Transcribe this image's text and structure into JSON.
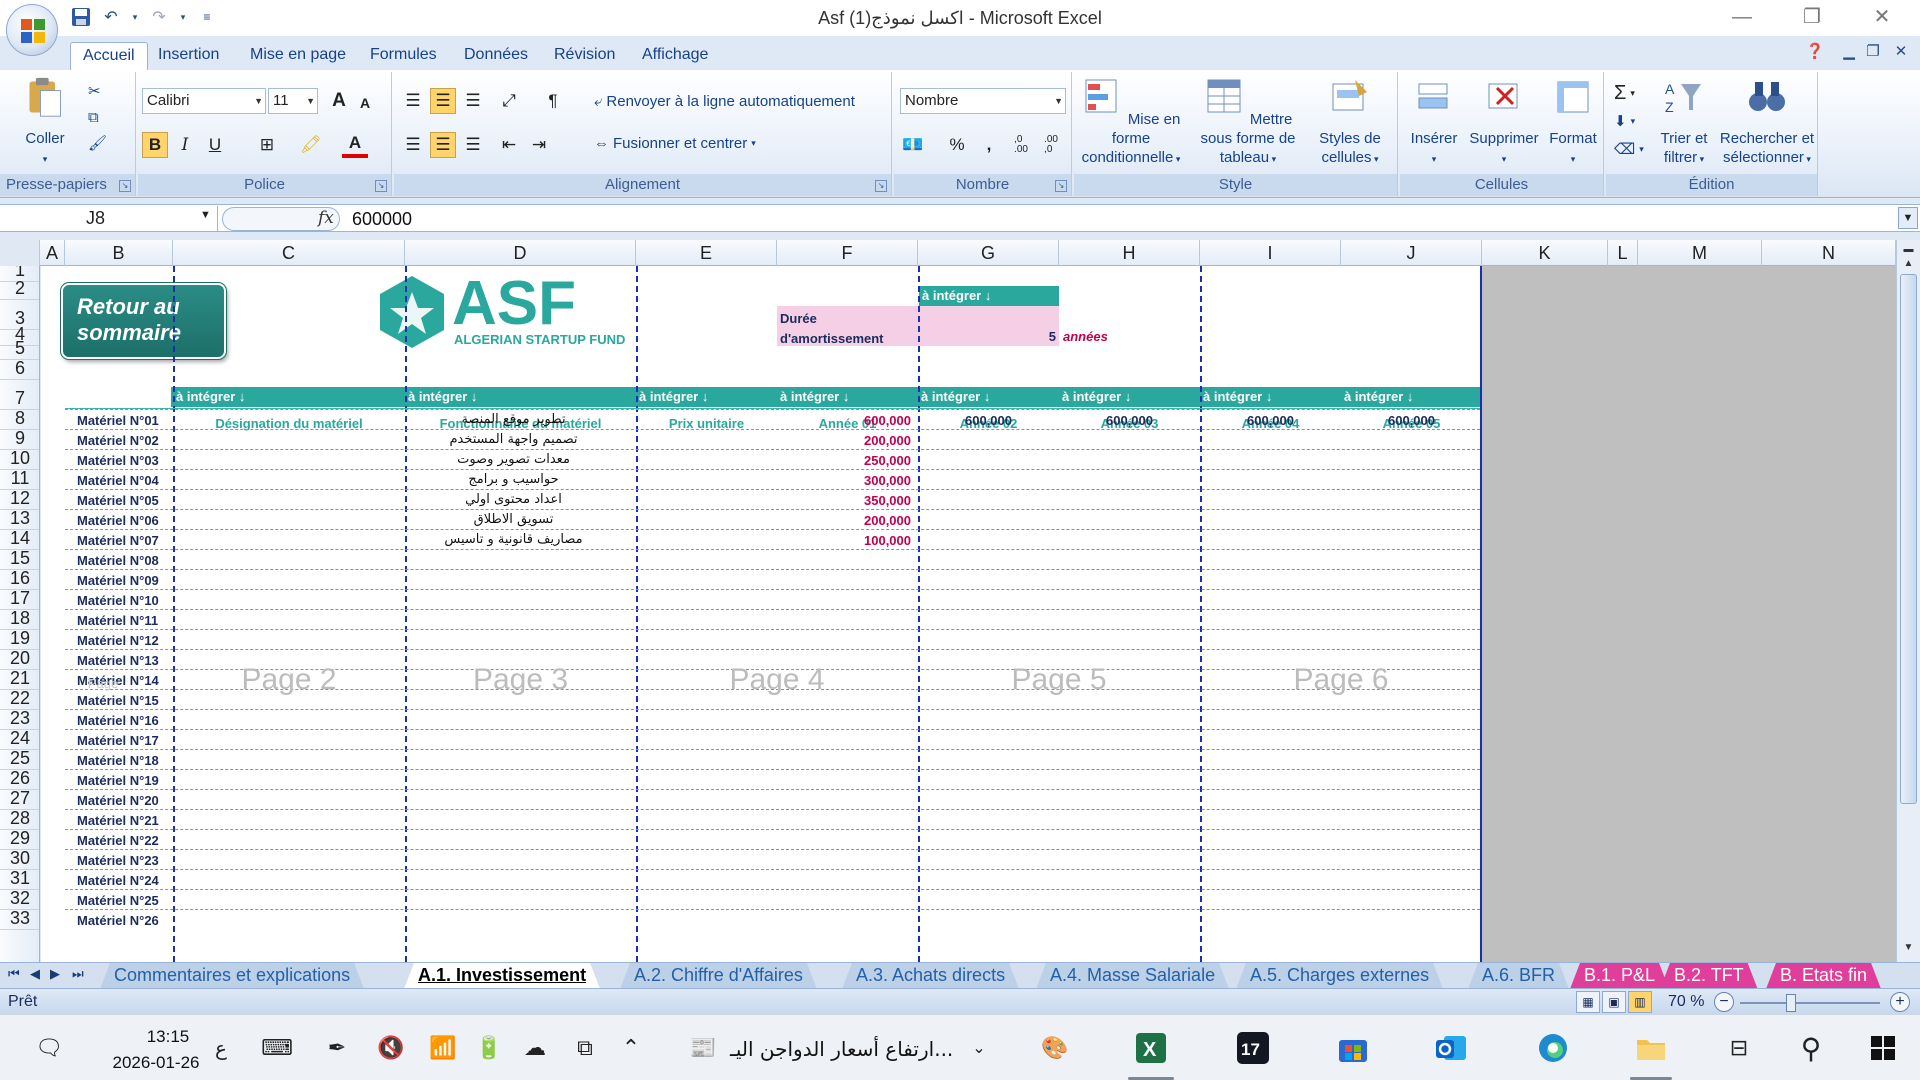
{
  "window": {
    "title": "Asf  اكسل نموذج(1) - Microsoft Excel",
    "minimize": "—",
    "restore": "❐",
    "close": "✕"
  },
  "ribbon_tabs": [
    "Accueil",
    "Insertion",
    "Mise en page",
    "Formules",
    "Données",
    "Révision",
    "Affichage"
  ],
  "ribbon": {
    "clipboard": {
      "group": "Presse-papiers",
      "paste": "Coller"
    },
    "font": {
      "group": "Police",
      "name": "Calibri",
      "size": "11",
      "bold": "B",
      "italic": "I",
      "underline": "U",
      "grow": "A",
      "shrink": "A",
      "color_letter": "A"
    },
    "alignment": {
      "group": "Alignement",
      "wrap": "Renvoyer à la ligne automatiquement",
      "merge": "Fusionner et centrer"
    },
    "number": {
      "group": "Nombre",
      "format": "Nombre",
      "percent": "%",
      "thousands": ",",
      "inc": ",0\n.00",
      "dec": ".00\n,0"
    },
    "style": {
      "group": "Style",
      "cond": "Mise en forme conditionnelle",
      "table": "Mettre sous forme de tableau",
      "cellstyles": "Styles de cellules"
    },
    "cells": {
      "group": "Cellules",
      "insert": "Insérer",
      "delete": "Supprimer",
      "format": "Format"
    },
    "editing": {
      "group": "Édition",
      "sum": "Σ",
      "sort": "Trier et filtrer",
      "find": "Rechercher et sélectionner"
    }
  },
  "formula_bar": {
    "name_box": "J8",
    "fx": "fx",
    "value": "600000"
  },
  "columns": [
    "A",
    "B",
    "C",
    "D",
    "E",
    "F",
    "G",
    "H",
    "I",
    "J",
    "K",
    "L",
    "M",
    "N"
  ],
  "rows": [
    "1",
    "2",
    "3",
    "4",
    "5",
    "6",
    "7",
    "8",
    "9",
    "10",
    "11",
    "12",
    "13",
    "14",
    "15",
    "16",
    "17",
    "18",
    "19",
    "20",
    "21",
    "22",
    "23",
    "24",
    "25",
    "26",
    "27",
    "28",
    "29",
    "30",
    "31",
    "32",
    "33"
  ],
  "sheet": {
    "retour_button": "Retour au sommaire",
    "logo": {
      "letters": "ASF",
      "subtitle": "ALGERIAN STARTUP FUND"
    },
    "duree": {
      "integ": "à intégrer ↓",
      "label": "Durée d'amortissement",
      "value": "5",
      "unit": "années"
    },
    "integ_label": "à intégrer ↓",
    "headers": [
      "Désignation du matériel",
      "Fonctionnalité du matériel",
      "Prix unitaire",
      "Année 01",
      "Année 02",
      "Année 03",
      "Année 04",
      "Année 05"
    ],
    "materials": [
      "Matériel N°01",
      "Matériel N°02",
      "Matériel N°03",
      "Matériel N°04",
      "Matériel N°05",
      "Matériel N°06",
      "Matériel N°07",
      "Matériel N°08",
      "Matériel N°09",
      "Matériel N°10",
      "Matériel N°11",
      "Matériel N°12",
      "Matériel N°13",
      "Matériel N°14",
      "Matériel N°15",
      "Matériel N°16",
      "Matériel N°17",
      "Matériel N°18",
      "Matériel N°19",
      "Matériel N°20",
      "Matériel N°21",
      "Matériel N°22",
      "Matériel N°23",
      "Matériel N°24",
      "Matériel N°25",
      "Matériel N°26"
    ],
    "functions": [
      "تطوير موقع المنصة",
      "تصميم واجهة المستخدم",
      "معدات تصوير وصوت",
      "حواسيب و برامج",
      "اعداد محتوى اولي",
      "تسويق الاطلاق",
      "مصاريف قانونية و تاسيس"
    ],
    "annee01": [
      "600,000",
      "200,000",
      "250,000",
      "300,000",
      "350,000",
      "200,000",
      "100,000"
    ],
    "row8_years": [
      "600,000",
      "600,000",
      "600,000",
      "600,000"
    ],
    "page_watermarks": [
      "Page 2",
      "Page 3",
      "Page 4",
      "Page 5",
      "Page 6"
    ],
    "faint_page": "Page"
  },
  "sheet_tabs": [
    "Commentaires et explications",
    "A.1. Investissement",
    "A.2. Chiffre d'Affaires",
    "A.3. Achats directs",
    "A.4. Masse Salariale",
    "A.5. Charges  externes",
    "A.6. BFR",
    "B.1. P&L",
    "B.2. TFT",
    "B. Etats fin"
  ],
  "status": {
    "text": "Prêt",
    "zoom": "70 %"
  },
  "taskbar": {
    "time": "13:15",
    "date": "2026-01-26",
    "lang": "ع",
    "news": "ارتفاع أسعار الدواجن اليـ..."
  }
}
